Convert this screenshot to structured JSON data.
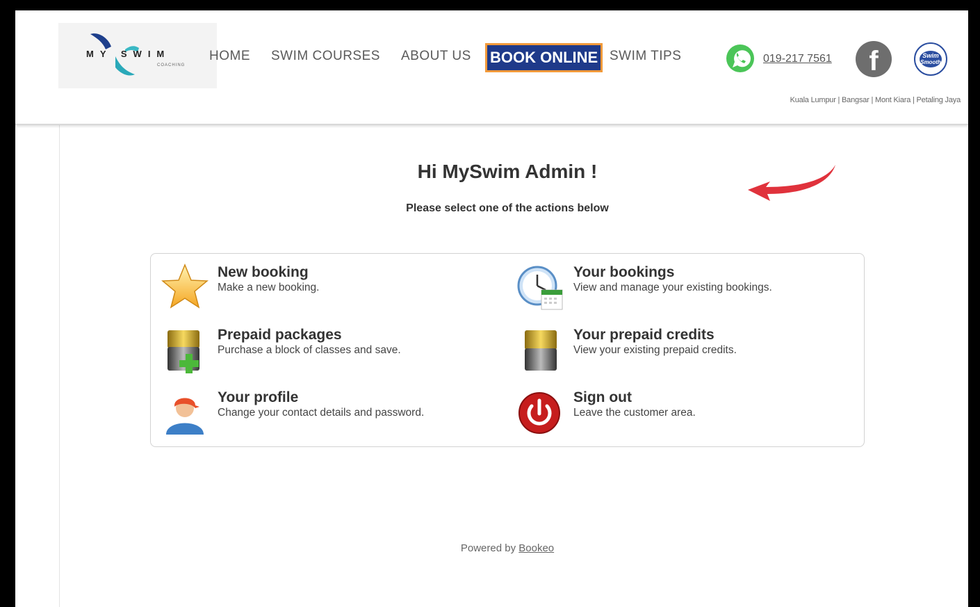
{
  "brand": {
    "logo_text": "MY SWIM",
    "logo_sub": "COACHING"
  },
  "nav": {
    "home": "HOME",
    "swim_courses": "SWIM COURSES",
    "about_us": "ABOUT US",
    "book_online": "BOOK ONLINE",
    "swim_tips": "SWIM TIPS"
  },
  "contact": {
    "phone": "019-217 7561"
  },
  "social": {
    "swim_smooth_text": "Swim Smooth"
  },
  "locations": "Kuala Lumpur | Bangsar | Mont Kiara | Petaling Jaya",
  "main": {
    "greeting": "Hi MySwim Admin !",
    "instruction": "Please select one of the actions below",
    "actions": [
      {
        "title": "New booking",
        "description": "Make a new booking.",
        "icon": "star-icon"
      },
      {
        "title": "Your bookings",
        "description": "View and manage your existing bookings.",
        "icon": "clock-calendar-icon"
      },
      {
        "title": "Prepaid packages",
        "description": "Purchase a block of classes and save.",
        "icon": "battery-add-icon"
      },
      {
        "title": "Your prepaid credits",
        "description": "View your existing prepaid credits.",
        "icon": "battery-icon"
      },
      {
        "title": "Your profile",
        "description": "Change your contact details and password.",
        "icon": "user-icon"
      },
      {
        "title": "Sign out",
        "description": "Leave the customer area.",
        "icon": "power-icon"
      }
    ]
  },
  "footer": {
    "powered_by": "Powered by",
    "link": "Bookeo"
  },
  "colors": {
    "nav_active_bg": "#1f3a8a",
    "nav_active_border": "#f29a3a",
    "annotation_arrow": "#e0323c",
    "whatsapp": "#4bc558"
  }
}
